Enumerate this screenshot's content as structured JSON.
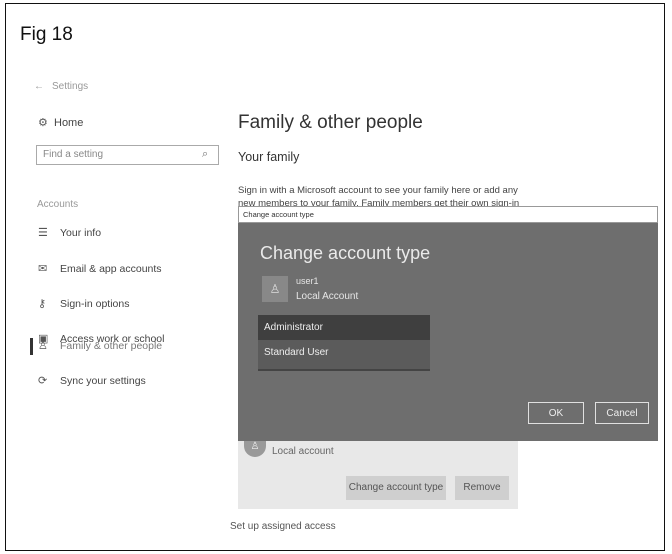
{
  "figure_label": "Fig 18",
  "window": {
    "back_label": "Settings"
  },
  "sidebar": {
    "home_label": "Home",
    "search_placeholder": "Find a setting",
    "section_title": "Accounts",
    "items": [
      {
        "label": "Your info",
        "icon": "person-card-icon"
      },
      {
        "label": "Email & app accounts",
        "icon": "mail-icon"
      },
      {
        "label": "Sign-in options",
        "icon": "key-icon"
      },
      {
        "label": "Access work or school",
        "icon": "briefcase-icon"
      },
      {
        "label": "Family & other people",
        "icon": "person-icon",
        "active": true
      },
      {
        "label": "Sync your settings",
        "icon": "sync-icon"
      }
    ]
  },
  "main": {
    "title": "Family & other people",
    "subheading": "Your family",
    "description_line1": "Sign in with a Microsoft account to see your family here or add any",
    "description_line2": "new members to your family. Family members get their own sign-in"
  },
  "dialog": {
    "window_title": "Change account type",
    "heading": "Change account type",
    "user_name": "user1",
    "user_type": "Local Account",
    "options": [
      "Administrator",
      "Standard User"
    ],
    "selected_option": "Administrator",
    "ok_label": "OK",
    "cancel_label": "Cancel"
  },
  "account_card": {
    "account_label": "Local account",
    "change_button": "Change account type",
    "remove_button": "Remove"
  },
  "assigned_access_link": "Set up assigned access"
}
